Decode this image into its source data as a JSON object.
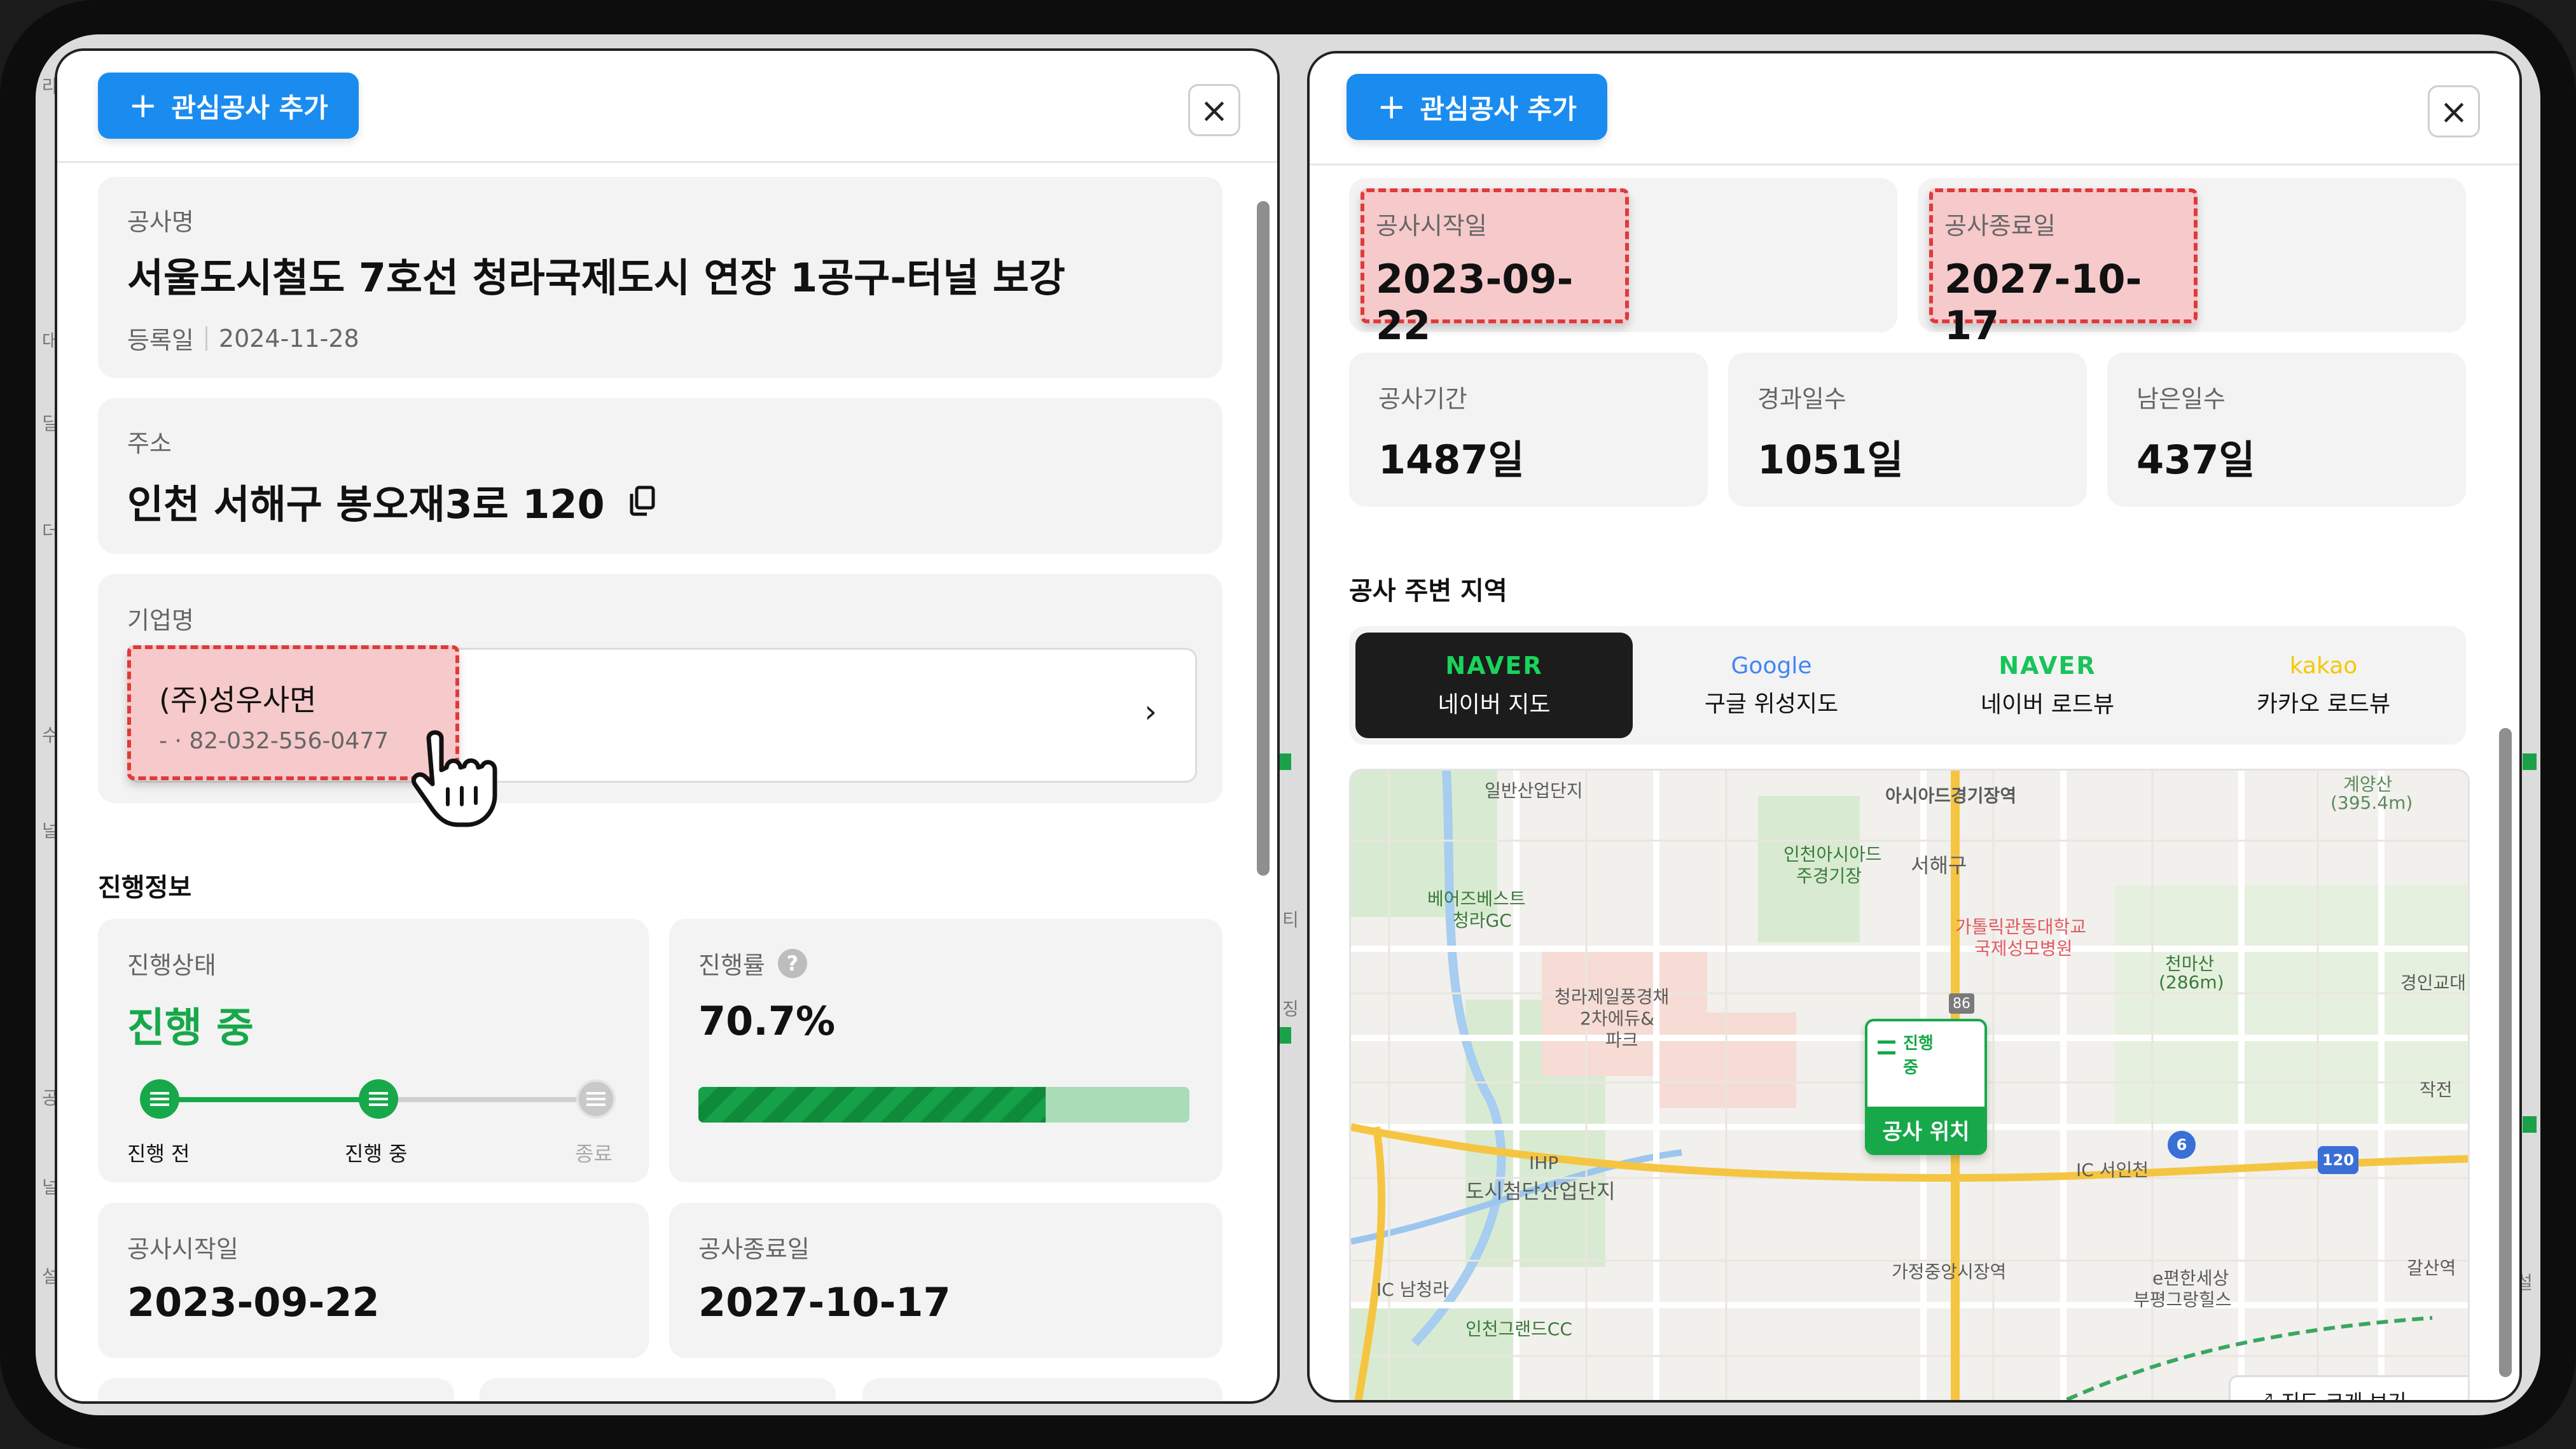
{
  "add_interest_label": "관심공사 추가",
  "left": {
    "project_name_label": "공사명",
    "project_name": "서울도시철도 7호선 청라국제도시 연장 1공구-터널 보강",
    "registered_label": "등록일",
    "registered_date": "2024-11-28",
    "address_label": "주소",
    "address": "인천 서해구 봉오재3로 120",
    "company_label": "기업명",
    "company_name": "(주)성우사면",
    "company_phone": "- · 82-032-556-0477",
    "progress_section": "진행정보",
    "status_label": "진행상태",
    "status_value": "진행 중",
    "steps": [
      "진행 전",
      "진행 중",
      "종료"
    ],
    "rate_label": "진행률",
    "rate_value": "70.7%",
    "rate_fraction": 0.707,
    "start_label": "공사시작일",
    "start_date": "2023-09-22",
    "end_label": "공사종료일",
    "end_date": "2027-10-17"
  },
  "right": {
    "start_label": "공사시작일",
    "start_date": "2023-09-22",
    "end_label": "공사종료일",
    "end_date": "2027-10-17",
    "period_label": "공사기간",
    "period_value": "1487일",
    "elapsed_label": "경과일수",
    "elapsed_value": "1051일",
    "remaining_label": "남은일수",
    "remaining_value": "437일",
    "nearby_title": "공사 주변 지역",
    "map_tabs": [
      {
        "brand": "NAVER",
        "label": "네이버 지도",
        "active": true
      },
      {
        "brand": "Google",
        "label": "구글 위성지도",
        "active": false
      },
      {
        "brand": "NAVER",
        "label": "네이버 로드뷰",
        "active": false
      },
      {
        "brand": "kakao",
        "label": "카카오 로드뷰",
        "active": false
      }
    ],
    "map_labels": {
      "l1": "일반산업단지",
      "l2": "아시아드경기장역",
      "l3": "계양산",
      "l3b": "(395.4m)",
      "l4": "인천아시아드",
      "l4b": "주경기장",
      "l5": "서해구",
      "l6": "베어즈베스트",
      "l6b": "청라GC",
      "l7": "가톨릭관동대학교",
      "l7b": "국제성모병원",
      "l8": "천마산",
      "l8b": "(286m)",
      "l9": "경인교대",
      "l10": "청라제일풍경채",
      "l10b": "2차에듀&",
      "l10c": "파크",
      "l11": "IHP",
      "l11b": "도시첨단산업단지",
      "l12": "작전",
      "l13": "IC 서인천",
      "l14": "IC 남청라",
      "l15": "인천그랜드CC",
      "l16": "가정중앙시장역",
      "l17": "e편한세상",
      "l17b": "부평그랑힐스",
      "l18": "갈산역",
      "route86": "86",
      "route6": "6",
      "route120": "120",
      "bottom_link": "지도 크게 보기"
    },
    "marker_status": "진행 중",
    "marker_label": "공사 위치"
  },
  "background_text": [
    "라",
    "대",
    "딜",
    "더",
    "수",
    "널",
    "티",
    "징",
    "공",
    "널",
    "설",
    "설"
  ],
  "colors": {
    "accent_blue": "#1a8cf0",
    "status_green": "#17a84a",
    "highlight_red": "#e03a3a"
  }
}
